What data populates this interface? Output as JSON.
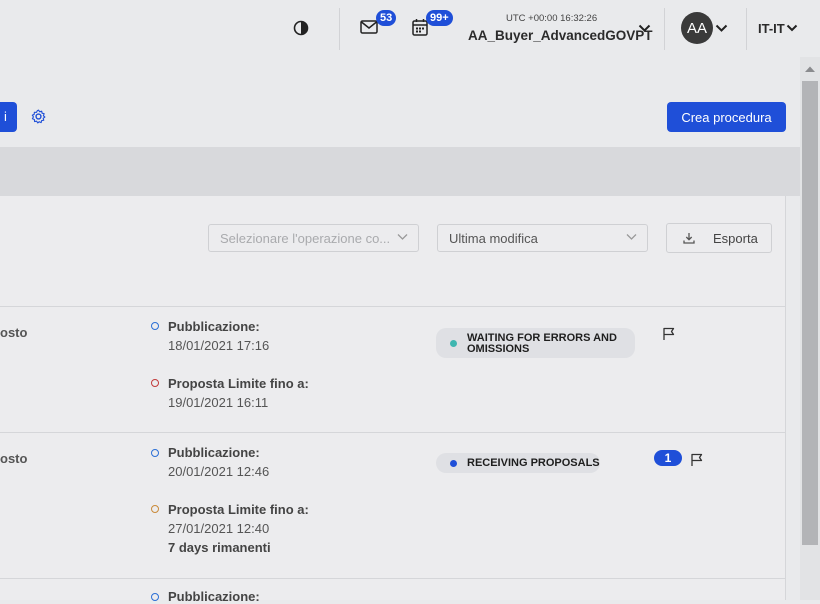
{
  "header": {
    "time": "UTC +00:00 16:32:26",
    "username": "AA_Buyer_AdvancedGOVPT",
    "mail_count": "53",
    "calendar_count": "99+",
    "avatar_initials": "AA",
    "language": "IT-IT"
  },
  "toolbar": {
    "create_label": "Crea procedura",
    "left_button_label": "i"
  },
  "filters": {
    "operation_placeholder": "Selezionare l'operazione co...",
    "sort_value": "Ultima modifica",
    "export_label": "Esporta"
  },
  "rows": [
    {
      "left_text": "osto",
      "pub_label": "Pubblicazione:",
      "pub_date": "18/01/2021 17:16",
      "deadline_label": "Proposta Limite fino a:",
      "deadline_date": "19/01/2021 16:11",
      "status_line1": "WAITING FOR ERRORS AND",
      "status_line2": "OMISSIONS",
      "status_color": "#3fb6b0"
    },
    {
      "left_text": "osto",
      "pub_label": "Pubblicazione:",
      "pub_date": "20/01/2021 12:46",
      "deadline_label": "Proposta Limite fino a:",
      "deadline_date": "27/01/2021 12:40",
      "remaining": "7 days rimanenti",
      "status": "RECEIVING PROPOSALS",
      "status_color": "#1f4fd8",
      "count": "1"
    },
    {
      "pub_label": "Pubblicazione:"
    }
  ],
  "colors": {
    "accent": "#1f4fd8",
    "dot_publication": "#2b6fd6",
    "dot_expired": "#c23a3a",
    "dot_pending": "#c98a3a"
  }
}
